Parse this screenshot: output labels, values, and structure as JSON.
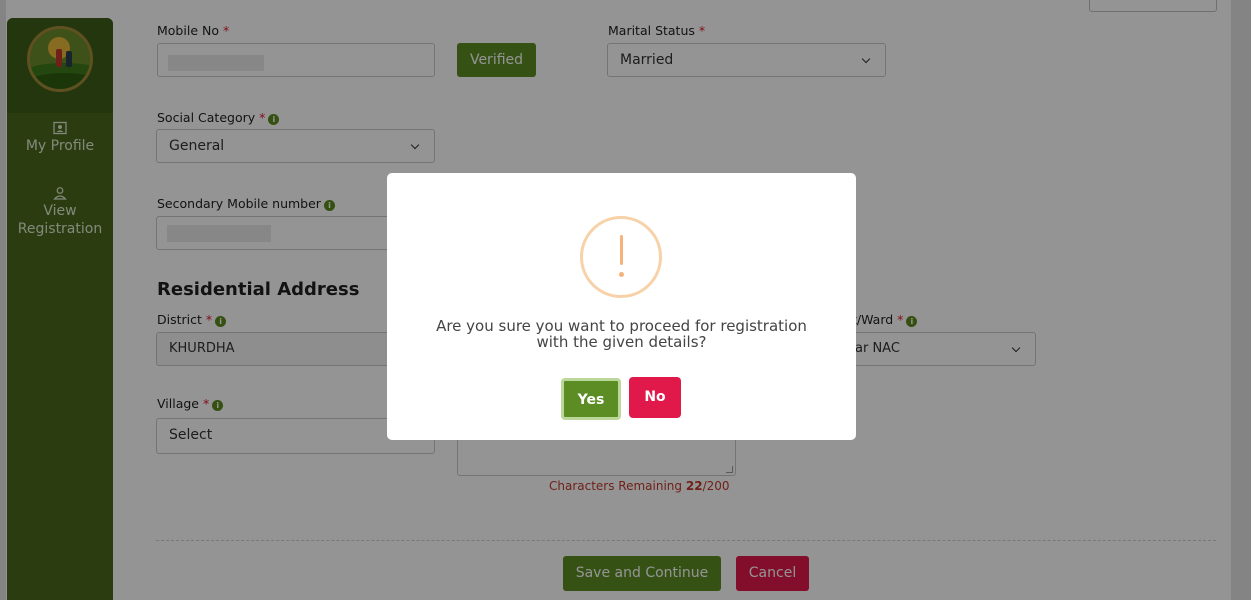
{
  "sidebar": {
    "logo": "kalia-logo",
    "items": [
      {
        "label": "My Profile",
        "icon": "profile-card-icon"
      },
      {
        "label": "View Registration",
        "icon": "user-icon"
      }
    ]
  },
  "form": {
    "mobile_label": "Mobile No",
    "verified_label": "Verified",
    "marital_label": "Marital Status",
    "marital_value": "Married",
    "social_label": "Social Category",
    "social_value": "General",
    "secondary_label": "Secondary Mobile number",
    "residential_title": "Residential Address",
    "district_label": "District",
    "district_value": "KHURDHA",
    "ward_label_partial": "t/Ward",
    "ward_value_partial": "ar NAC",
    "village_label": "Village",
    "village_value": "Select",
    "chars_prefix": "Characters Remaining",
    "chars_remaining": "22",
    "chars_total": "/200",
    "save_label": "Save and Continue",
    "cancel_label": "Cancel",
    "required_mark": "*",
    "info_glyph": "i"
  },
  "modal": {
    "line1": "Are you sure you want to proceed for registration",
    "line2": "with the given details?",
    "yes_label": "Yes",
    "no_label": "No",
    "icon": "warning-icon"
  },
  "colors": {
    "sidebar": "#4a6a1c",
    "primary_green": "#5c8d24",
    "danger_red": "#e0194a",
    "warning_orange": "#f5b27a"
  }
}
